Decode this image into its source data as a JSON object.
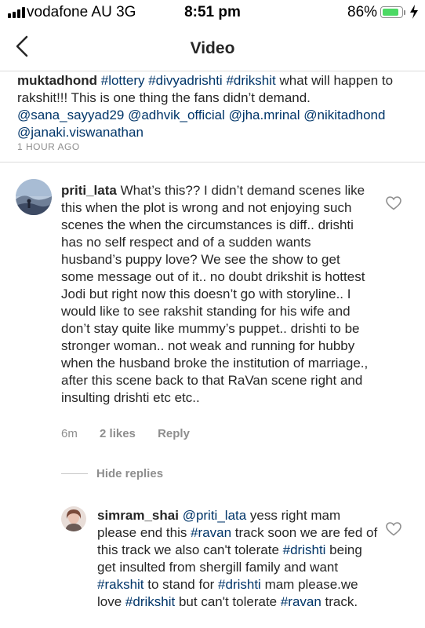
{
  "status_bar": {
    "carrier": "vodafone AU  3G",
    "time": "8:51 pm",
    "battery_percent": "86%",
    "battery_level": 0.86,
    "signal_bars": 4
  },
  "nav": {
    "title": "Video",
    "back_icon": "chevron-left-icon"
  },
  "caption": {
    "username": "muktadhond",
    "parts": [
      {
        "text": "#lottery",
        "tag": true
      },
      {
        "text": " ",
        "tag": false
      },
      {
        "text": "#divyadrishti",
        "tag": true
      },
      {
        "text": " ",
        "tag": false
      },
      {
        "text": "#drikshit",
        "tag": true
      },
      {
        "text": " what will happen to rakshit!!! This is one thing the fans didn’t demand. ",
        "tag": false
      },
      {
        "text": "@sana_sayyad29",
        "tag": true
      },
      {
        "text": " ",
        "tag": false
      },
      {
        "text": "@adhvik_official",
        "tag": true
      },
      {
        "text": " ",
        "tag": false
      },
      {
        "text": "@jha.mrinal",
        "tag": true
      },
      {
        "text": " ",
        "tag": false
      },
      {
        "text": "@nikitadhond",
        "tag": true
      },
      {
        "text": " ",
        "tag": false
      },
      {
        "text": "@janaki.viswanathan",
        "tag": true
      }
    ],
    "timestamp": "1 HOUR AGO"
  },
  "comments": [
    {
      "username": "priti_lata",
      "parts": [
        {
          "text": "What’s this?? I didn’t demand scenes like this when the plot is wrong and not enjoying such scenes the when the circumstances is diff.. drishti has no self respect and of a sudden wants husband’s puppy love?  We see the show to get some message out of it.. no doubt drikshit is hottest Jodi but right now this doesn’t go with storyline.. I would like to see rakshit standing for his wife and don’t stay quite like mummy’s puppet.. drishti to be stronger woman.. not weak and running for hubby when the husband broke the institution of marriage., after this scene back to that RaVan  scene right and insulting drishti etc etc..",
          "tag": false
        }
      ],
      "time": "6m",
      "likes": "2 likes",
      "reply": "Reply",
      "like_icon": "heart-outline-icon"
    },
    {
      "username": "simram_shai",
      "parts": [
        {
          "text": "@priti_lata",
          "tag": true
        },
        {
          "text": " yess right mam please end this ",
          "tag": false
        },
        {
          "text": "#ravan",
          "tag": true
        },
        {
          "text": " track soon we are fed of this track we also can't tolerate ",
          "tag": false
        },
        {
          "text": "#drishti",
          "tag": true
        },
        {
          "text": " being get insulted from shergill family and want ",
          "tag": false
        },
        {
          "text": "#rakshit",
          "tag": true
        },
        {
          "text": " to stand for ",
          "tag": false
        },
        {
          "text": "#drishti",
          "tag": true
        },
        {
          "text": " mam please.we love ",
          "tag": false
        },
        {
          "text": "#drikshit",
          "tag": true
        },
        {
          "text": " but can't tolerate ",
          "tag": false
        },
        {
          "text": "#ravan",
          "tag": true
        },
        {
          "text": " track.",
          "tag": false
        }
      ],
      "like_icon": "heart-outline-icon"
    }
  ],
  "hide_replies": "Hide replies",
  "colors": {
    "link": "#003569",
    "muted": "#8e8e8e",
    "battery": "#4cd964"
  }
}
